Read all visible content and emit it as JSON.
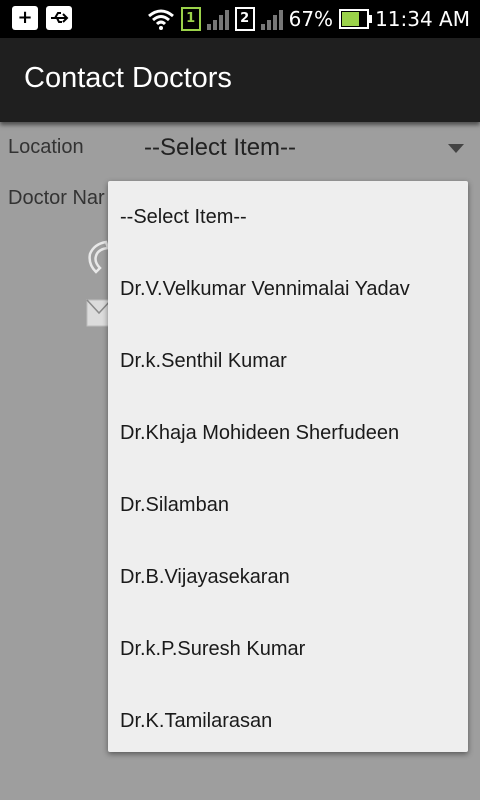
{
  "status_bar": {
    "battery": "67%",
    "time": "11:34 AM",
    "sim1": "1",
    "sim2": "2",
    "battery_level": 0.67,
    "icons": [
      "add-icon",
      "usb-icon",
      "wifi-icon",
      "sim1-icon",
      "signal-icon",
      "sim2-icon",
      "signal-icon",
      "battery-charging-icon"
    ]
  },
  "action_bar": {
    "title": "Contact Doctors"
  },
  "form": {
    "location_label": "Location",
    "location_value": "--Select Item--",
    "doctor_label": "Doctor Nar"
  },
  "dropdown": {
    "items": [
      "--Select Item--",
      "Dr.V.Velkumar Vennimalai Yadav",
      "Dr.k.Senthil Kumar",
      "Dr.Khaja Mohideen Sherfudeen",
      "Dr.Silamban",
      "Dr.B.Vijayasekaran",
      "Dr.k.P.Suresh Kumar",
      "Dr.K.Tamilarasan"
    ]
  }
}
